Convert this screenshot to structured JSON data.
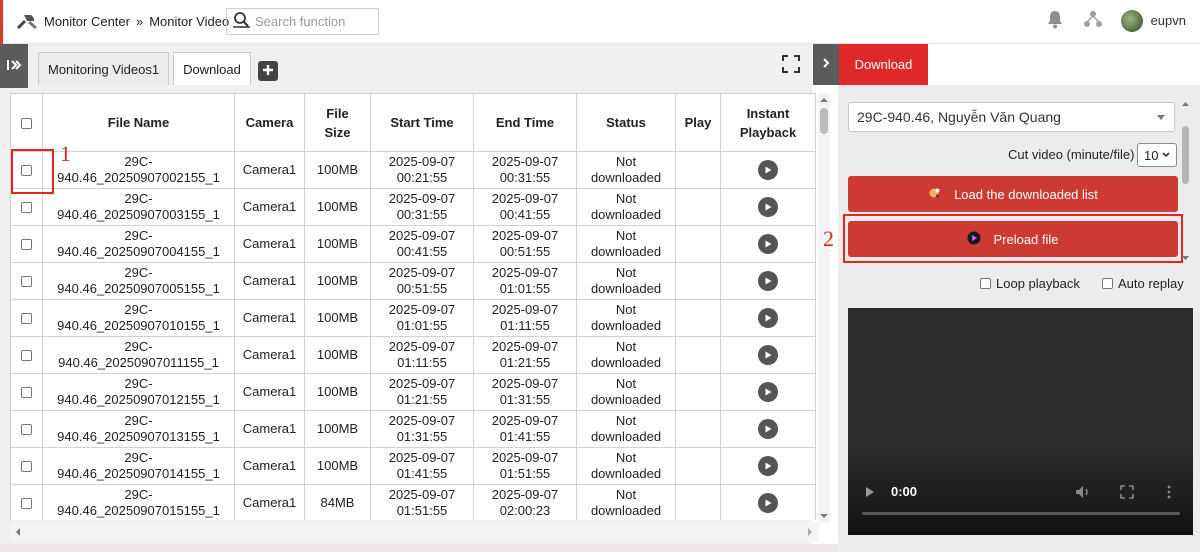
{
  "header": {
    "breadcrumb_home": "Monitor Center",
    "breadcrumb_sep": "»",
    "breadcrumb_current": "Monitor Video",
    "search_placeholder": "Search function",
    "username": "eupvn"
  },
  "tabs": [
    {
      "label": "Monitoring Videos1",
      "active": false
    },
    {
      "label": "Download",
      "active": true
    }
  ],
  "table": {
    "columns": [
      "File Name",
      "Camera",
      "File Size",
      "Start Time",
      "End Time",
      "Status",
      "Play",
      "Instant Playback"
    ],
    "rows": [
      {
        "file_line1": "29C-",
        "file_line2": "940.46_20250907002155_1",
        "camera": "Camera1",
        "size": "100MB",
        "start_date": "2025-09-07",
        "start_time": "00:21:55",
        "end_date": "2025-09-07",
        "end_time": "00:31:55",
        "status_line1": "Not",
        "status_line2": "downloaded"
      },
      {
        "file_line1": "29C-",
        "file_line2": "940.46_20250907003155_1",
        "camera": "Camera1",
        "size": "100MB",
        "start_date": "2025-09-07",
        "start_time": "00:31:55",
        "end_date": "2025-09-07",
        "end_time": "00:41:55",
        "status_line1": "Not",
        "status_line2": "downloaded"
      },
      {
        "file_line1": "29C-",
        "file_line2": "940.46_20250907004155_1",
        "camera": "Camera1",
        "size": "100MB",
        "start_date": "2025-09-07",
        "start_time": "00:41:55",
        "end_date": "2025-09-07",
        "end_time": "00:51:55",
        "status_line1": "Not",
        "status_line2": "downloaded"
      },
      {
        "file_line1": "29C-",
        "file_line2": "940.46_20250907005155_1",
        "camera": "Camera1",
        "size": "100MB",
        "start_date": "2025-09-07",
        "start_time": "00:51:55",
        "end_date": "2025-09-07",
        "end_time": "01:01:55",
        "status_line1": "Not",
        "status_line2": "downloaded"
      },
      {
        "file_line1": "29C-",
        "file_line2": "940.46_20250907010155_1",
        "camera": "Camera1",
        "size": "100MB",
        "start_date": "2025-09-07",
        "start_time": "01:01:55",
        "end_date": "2025-09-07",
        "end_time": "01:11:55",
        "status_line1": "Not",
        "status_line2": "downloaded"
      },
      {
        "file_line1": "29C-",
        "file_line2": "940.46_20250907011155_1",
        "camera": "Camera1",
        "size": "100MB",
        "start_date": "2025-09-07",
        "start_time": "01:11:55",
        "end_date": "2025-09-07",
        "end_time": "01:21:55",
        "status_line1": "Not",
        "status_line2": "downloaded"
      },
      {
        "file_line1": "29C-",
        "file_line2": "940.46_20250907012155_1",
        "camera": "Camera1",
        "size": "100MB",
        "start_date": "2025-09-07",
        "start_time": "01:21:55",
        "end_date": "2025-09-07",
        "end_time": "01:31:55",
        "status_line1": "Not",
        "status_line2": "downloaded"
      },
      {
        "file_line1": "29C-",
        "file_line2": "940.46_20250907013155_1",
        "camera": "Camera1",
        "size": "100MB",
        "start_date": "2025-09-07",
        "start_time": "01:31:55",
        "end_date": "2025-09-07",
        "end_time": "01:41:55",
        "status_line1": "Not",
        "status_line2": "downloaded"
      },
      {
        "file_line1": "29C-",
        "file_line2": "940.46_20250907014155_1",
        "camera": "Camera1",
        "size": "100MB",
        "start_date": "2025-09-07",
        "start_time": "01:41:55",
        "end_date": "2025-09-07",
        "end_time": "01:51:55",
        "status_line1": "Not",
        "status_line2": "downloaded"
      },
      {
        "file_line1": "29C-",
        "file_line2": "940.46_20250907015155_1",
        "camera": "Camera1",
        "size": "84MB",
        "start_date": "2025-09-07",
        "start_time": "01:51:55",
        "end_date": "2025-09-07",
        "end_time": "02:00:23",
        "status_line1": "Not",
        "status_line2": "downloaded"
      }
    ]
  },
  "right_panel": {
    "tab_label": "Download",
    "vehicle_select": "29C-940.46, Nguyễn Văn Quang",
    "cut_label": "Cut video (minute/file)",
    "cut_value": "10",
    "load_button": "Load the downloaded list",
    "preload_button": "Preload file",
    "loop_label": "Loop playback",
    "auto_replay_label": "Auto replay",
    "video_time": "0:00"
  },
  "annotations": {
    "step1": "1",
    "step2": "2"
  },
  "colors": {
    "accent_red": "#e0272a",
    "button_red": "#cc3a33",
    "annotation_red": "#e52620"
  }
}
